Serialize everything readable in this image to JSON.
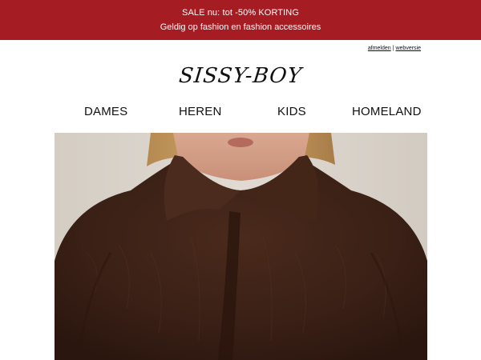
{
  "banner": {
    "line1": "SALE nu: tot -50% KORTING",
    "line2": "Geldig op fashion en fashion accessoires",
    "color": "#a51c22"
  },
  "utility": {
    "unsubscribe": "afmelden",
    "separator": "|",
    "webversion": "webversie"
  },
  "brand": {
    "logo_text": "SISSY-BOY"
  },
  "nav": {
    "items": [
      {
        "label": "DAMES"
      },
      {
        "label": "HEREN"
      },
      {
        "label": "KIDS"
      },
      {
        "label": "HOMELAND"
      }
    ]
  },
  "hero": {
    "alt_subject": "woman-in-brown-faux-fur-coat",
    "background_color": "#d9d3cb",
    "coat_color": "#3a2016"
  }
}
